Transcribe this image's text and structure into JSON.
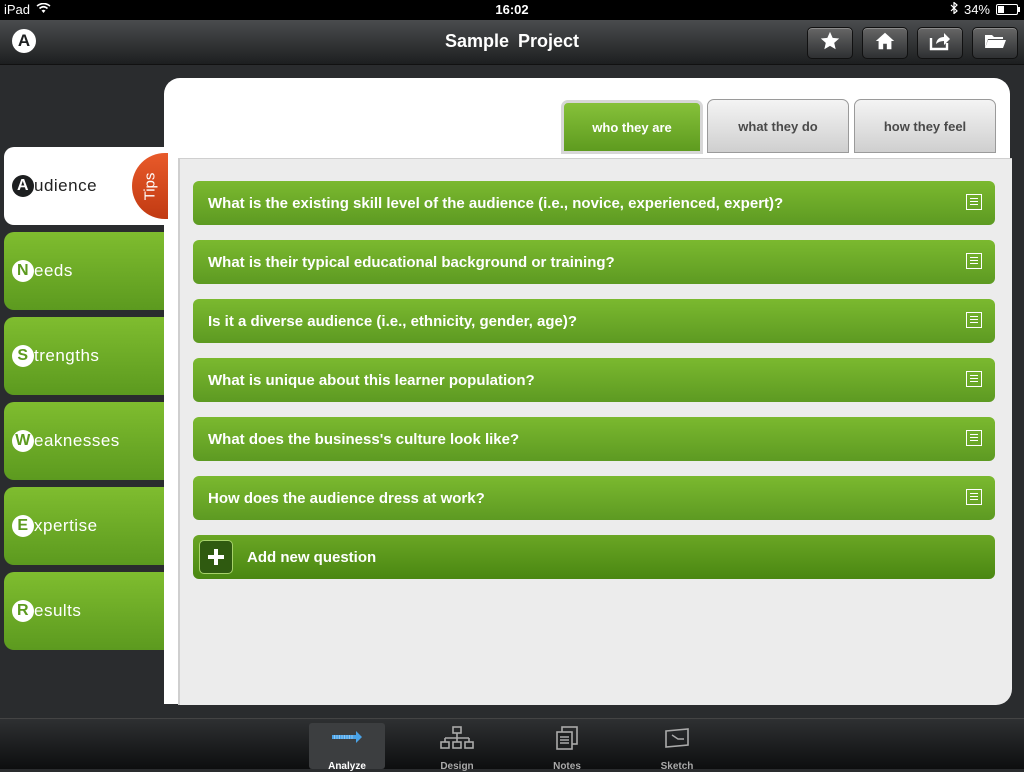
{
  "status_bar": {
    "device": "iPad",
    "time": "16:02",
    "battery": "34%",
    "battery_fraction": 0.34
  },
  "nav": {
    "title": "Sample  Project",
    "logo": "A"
  },
  "left_tabs": [
    {
      "letter": "A",
      "rest": "udience",
      "active": true
    },
    {
      "letter": "N",
      "rest": "eeds"
    },
    {
      "letter": "S",
      "rest": "trengths"
    },
    {
      "letter": "W",
      "rest": "eaknesses"
    },
    {
      "letter": "E",
      "rest": "xpertise"
    },
    {
      "letter": "R",
      "rest": "esults"
    }
  ],
  "tips_label": "Tips",
  "top_tabs": [
    "who they are",
    "what they do",
    "how they feel"
  ],
  "questions": [
    "What is the existing skill level of the audience (i.e., novice, experienced, expert)?",
    "What is their typical educational background or training?",
    "Is it a diverse audience (i.e., ethnicity, gender, age)?",
    "What is unique about this learner population?",
    "What does the business's culture look like?",
    "How does the audience dress at work?"
  ],
  "add_question_label": "Add new question",
  "tab_bar": [
    "Analyze",
    "Design",
    "Notes",
    "Sketch"
  ],
  "icons": {
    "nav_buttons": [
      "star-icon",
      "home-icon",
      "share-icon",
      "folder-icon"
    ],
    "tab_bar": [
      "analyze-icon",
      "design-icon",
      "notes-icon",
      "sketch-icon"
    ]
  },
  "colors": {
    "accent_green": "#6aaa28",
    "tips_orange": "#d9481c",
    "background": "#2a2c2e"
  }
}
